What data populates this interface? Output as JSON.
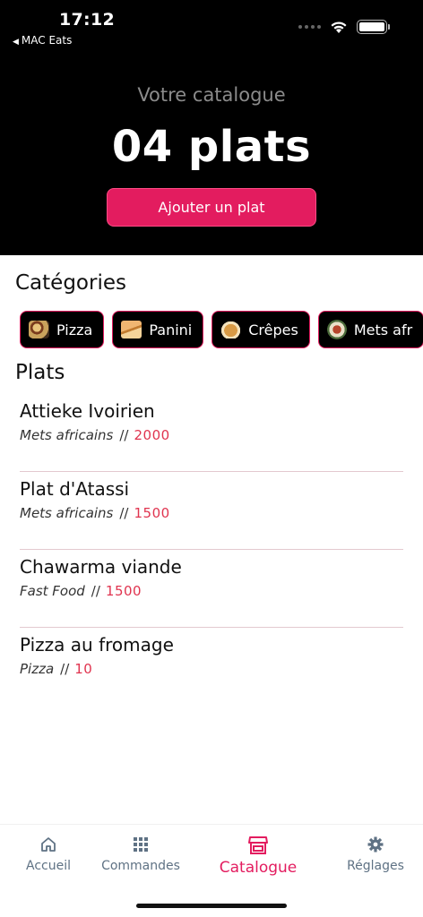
{
  "status_bar": {
    "time": "17:12",
    "back_app": "MAC Eats"
  },
  "header": {
    "subtitle": "Votre catalogue",
    "count": "04 plats",
    "add_button": "Ajouter un plat"
  },
  "categories": {
    "title": "Catégories",
    "items": [
      {
        "label": "Pizza",
        "icon": "pizza-thumbnail"
      },
      {
        "label": "Panini",
        "icon": "panini-thumbnail"
      },
      {
        "label": "Crêpes",
        "icon": "crepe-thumbnail"
      },
      {
        "label": "Mets afr",
        "icon": "african-dish-thumbnail"
      }
    ]
  },
  "plats": {
    "title": "Plats",
    "items": [
      {
        "name": "Attieke Ivoirien",
        "category": "Mets africains",
        "separator": "//",
        "price": "2000"
      },
      {
        "name": "Plat d'Atassi",
        "category": "Mets africains",
        "separator": "//",
        "price": "1500"
      },
      {
        "name": "Chawarma viande",
        "category": "Fast Food",
        "separator": "//",
        "price": "1500"
      },
      {
        "name": "Pizza au fromage",
        "category": "Pizza",
        "separator": "//",
        "price": "10"
      }
    ]
  },
  "tabbar": {
    "home": "Accueil",
    "orders": "Commandes",
    "catalogue": "Catalogue",
    "settings": "Réglages",
    "active": "catalogue"
  },
  "colors": {
    "accent": "#e31c5f",
    "price": "#e0344f",
    "header_bg": "#000000",
    "tab_inactive": "#5f7284"
  }
}
